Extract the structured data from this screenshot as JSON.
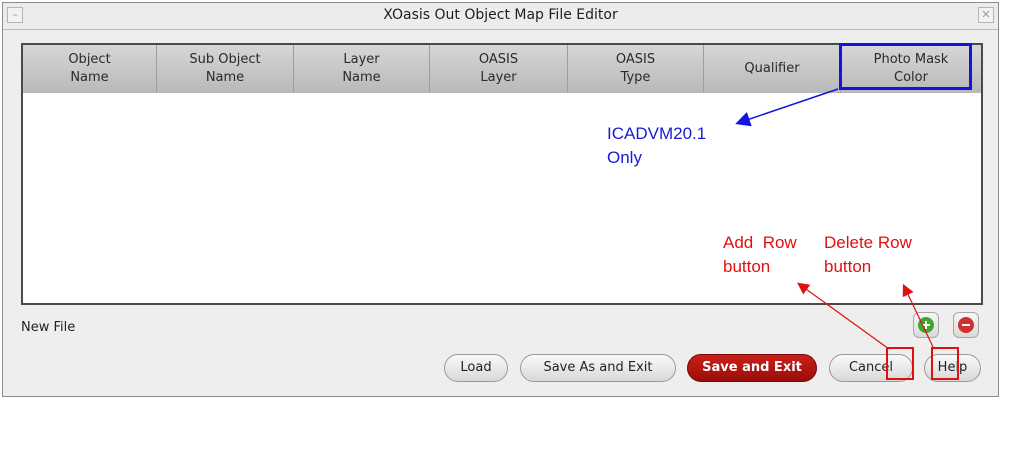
{
  "window": {
    "title": "XOasis Out Object Map File Editor",
    "minimize_glyph": "–",
    "close_glyph": "✕"
  },
  "table": {
    "columns": [
      "Object\nName",
      "Sub Object\nName",
      "Layer\nName",
      "OASIS\nLayer",
      "OASIS\nType",
      "Qualifier",
      "Photo Mask\nColor"
    ],
    "rows": []
  },
  "status": {
    "text": "New File"
  },
  "row_buttons": {
    "add_icon": "plus-circle-icon",
    "delete_icon": "minus-circle-icon",
    "add_color": "#3fa535",
    "delete_color": "#d03030"
  },
  "buttons": {
    "load": "Load",
    "save_as_exit": "Save As and Exit",
    "save_exit": "Save and Exit",
    "cancel": "Cancel",
    "help": "Help"
  },
  "annotations": {
    "photo_mask_note_line1": "ICADVM20.1",
    "photo_mask_note_line2": "Only",
    "add_row_line1": "Add  Row",
    "add_row_line2": "button",
    "delete_row_line1": "Delete Row",
    "delete_row_line2": "button",
    "blue_color": "#1a1ad6",
    "red_color": "#e01010"
  }
}
